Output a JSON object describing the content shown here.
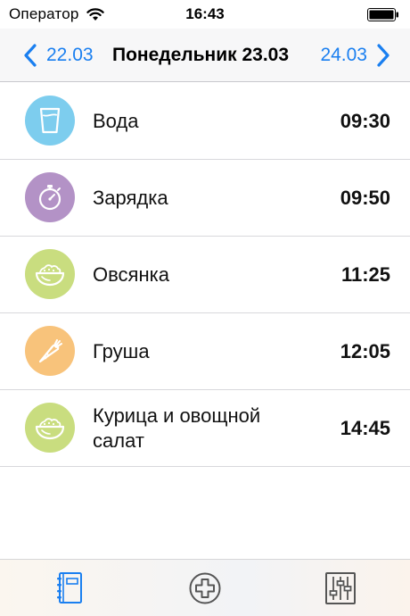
{
  "status_bar": {
    "carrier": "Оператор",
    "time": "16:43"
  },
  "nav": {
    "prev_date": "22.03",
    "title": "Понедельник 23.03",
    "next_date": "24.03"
  },
  "items": [
    {
      "name": "Вода",
      "time": "09:30",
      "icon": "water-glass-icon",
      "color": "#7dcdee"
    },
    {
      "name": "Зарядка",
      "time": "09:50",
      "icon": "stopwatch-icon",
      "color": "#b392c6"
    },
    {
      "name": "Овсянка",
      "time": "11:25",
      "icon": "bowl-icon",
      "color": "#c9dd7f"
    },
    {
      "name": "Груша",
      "time": "12:05",
      "icon": "carrot-icon",
      "color": "#f8c37b"
    },
    {
      "name": "Курица и овощной салат",
      "time": "14:45",
      "icon": "bowl-icon",
      "color": "#c9dd7f"
    }
  ],
  "tabs": [
    {
      "icon": "journal-icon",
      "color": "#1a7ff0"
    },
    {
      "icon": "add-circle-icon",
      "color": "#555555"
    },
    {
      "icon": "sliders-icon",
      "color": "#555555"
    }
  ]
}
